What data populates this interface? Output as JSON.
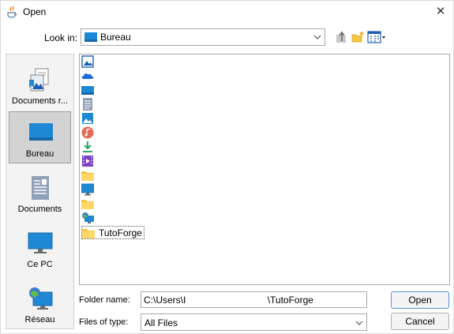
{
  "window": {
    "title": "Open"
  },
  "lookin": {
    "label": "Look in:",
    "value": "Bureau"
  },
  "sidebar": {
    "items": [
      {
        "label": "Documents r..."
      },
      {
        "label": "Bureau"
      },
      {
        "label": "Documents"
      },
      {
        "label": "Ce PC"
      },
      {
        "label": "Réseau"
      }
    ]
  },
  "files": [
    {
      "icon": "image-icon",
      "name": ""
    },
    {
      "icon": "onedrive-icon",
      "name": ""
    },
    {
      "icon": "drive-icon",
      "name": ""
    },
    {
      "icon": "document-icon",
      "name": ""
    },
    {
      "icon": "image-icon",
      "name": ""
    },
    {
      "icon": "music-icon",
      "name": ""
    },
    {
      "icon": "download-icon",
      "name": ""
    },
    {
      "icon": "video-icon",
      "name": ""
    },
    {
      "icon": "folder-icon",
      "name": ""
    },
    {
      "icon": "monitor-icon",
      "name": ""
    },
    {
      "icon": "folder-icon",
      "name": ""
    },
    {
      "icon": "network-icon",
      "name": ""
    },
    {
      "icon": "folder-icon",
      "name": "TutoForge"
    }
  ],
  "bottom": {
    "folder_label": "Folder name:",
    "folder_value": "C:\\Users\\I                               \\TutoForge",
    "type_label": "Files of type:",
    "type_value": "All Files",
    "open_label": "Open",
    "cancel_label": "Cancel"
  },
  "colors": {
    "accent": "#1e88d4",
    "folder": "#f5c542",
    "selection": "#d3d3d3"
  }
}
